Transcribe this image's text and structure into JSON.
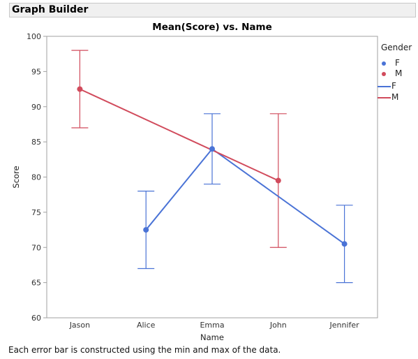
{
  "window": {
    "title": "Graph Builder"
  },
  "footnote": "Each error bar is constructed using the min and max of the data.",
  "colors": {
    "F": "#4A73D6",
    "M": "#D14B5C",
    "axis": "#a0a0a0"
  },
  "legend": {
    "title": "Gender",
    "items": [
      {
        "kind": "marker",
        "label": "F",
        "series": "F"
      },
      {
        "kind": "marker",
        "label": "M",
        "series": "M"
      },
      {
        "kind": "line",
        "label": "F",
        "series": "F"
      },
      {
        "kind": "line",
        "label": "M",
        "series": "M"
      }
    ]
  },
  "chart_data": {
    "type": "line",
    "title": "Mean(Score) vs. Name",
    "xlabel": "Name",
    "ylabel": "Score",
    "categories": [
      "Jason",
      "Alice",
      "Emma",
      "John",
      "Jennifer"
    ],
    "ylim": [
      60,
      100
    ],
    "yticks": [
      60,
      65,
      70,
      75,
      80,
      85,
      90,
      95,
      100
    ],
    "grid": false,
    "legend_position": "right",
    "error_bars": "min-max",
    "series": [
      {
        "name": "F",
        "points": [
          {
            "category": "Alice",
            "mean": 72.5,
            "min": 67,
            "max": 78
          },
          {
            "category": "Emma",
            "mean": 84,
            "min": 79,
            "max": 89
          },
          {
            "category": "Jennifer",
            "mean": 70.5,
            "min": 65,
            "max": 76
          }
        ]
      },
      {
        "name": "M",
        "points": [
          {
            "category": "Jason",
            "mean": 92.5,
            "min": 87,
            "max": 98
          },
          {
            "category": "John",
            "mean": 79.5,
            "min": 70,
            "max": 89
          }
        ]
      }
    ]
  }
}
